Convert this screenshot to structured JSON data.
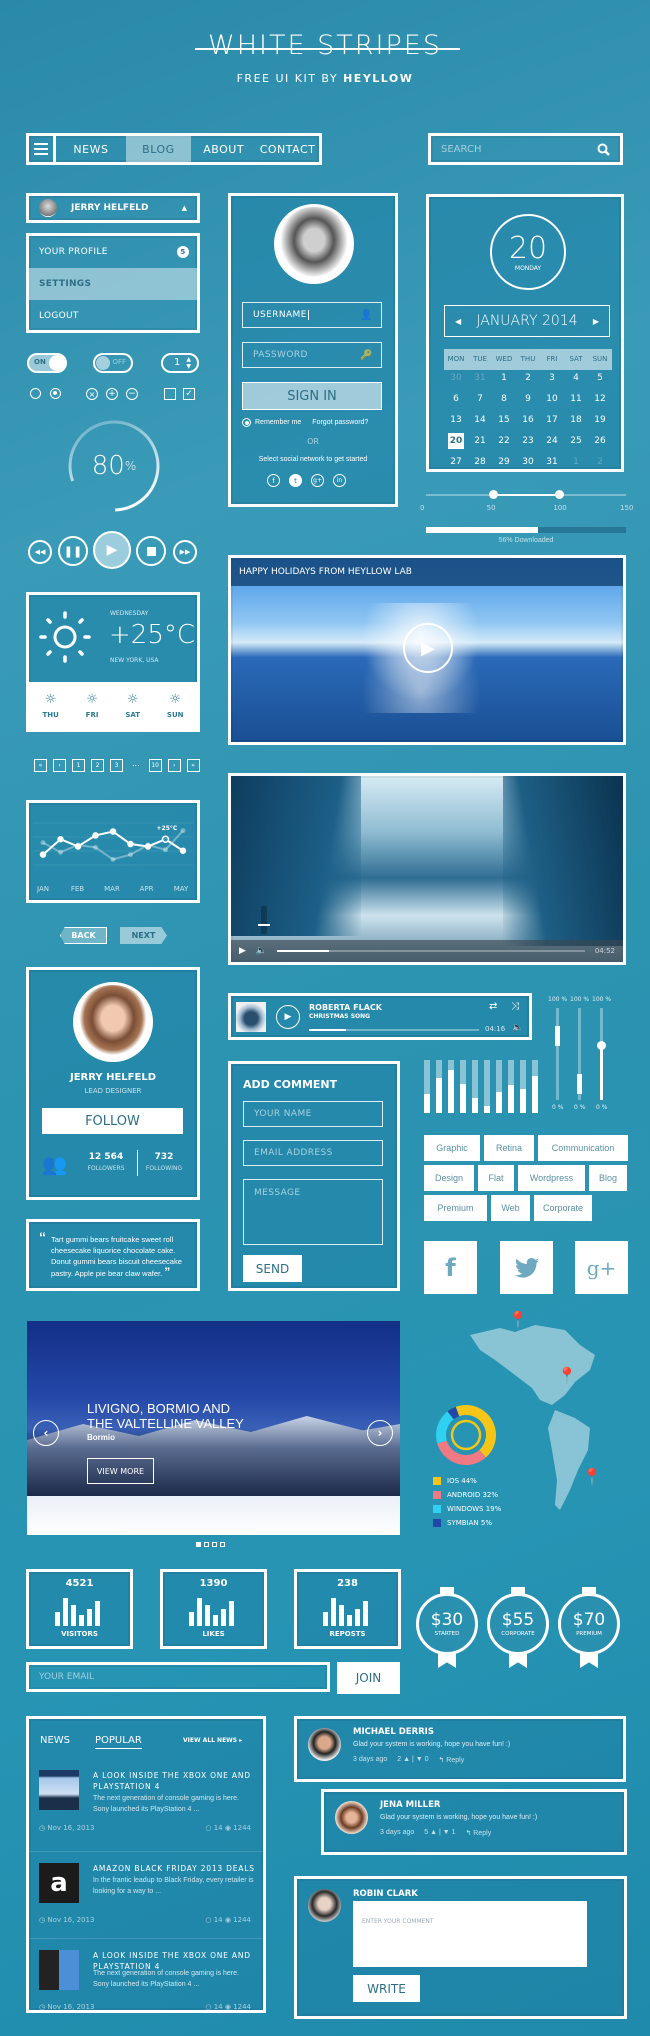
{
  "header": {
    "title": "WHITE STRIPES",
    "subtitle_prefix": "FREE UI KIT BY ",
    "subtitle_brand": "HEYLLOW"
  },
  "nav": {
    "items": [
      {
        "label": "NEWS"
      },
      {
        "label": "BLOG",
        "active": true
      },
      {
        "label": "ABOUT"
      },
      {
        "label": "CONTACT"
      }
    ],
    "search_placeholder": "SEARCH"
  },
  "user_dropdown": {
    "name": "JERRY HELFELD",
    "items": [
      {
        "label": "YOUR PROFILE",
        "badge": "5"
      },
      {
        "label": "SETTINGS",
        "active": true
      },
      {
        "label": "LOGOUT"
      }
    ]
  },
  "controls": {
    "toggle_on": "ON",
    "toggle_off": "OFF",
    "stepper_value": "1"
  },
  "progress_ring": {
    "value": 80,
    "label": "80",
    "unit": "%"
  },
  "login": {
    "username_value": "USERNAME",
    "password_placeholder": "PASSWORD",
    "sign_in": "SIGN IN",
    "remember": "Remember me",
    "forgot": "Forgot password?",
    "or": "OR",
    "social_prompt": "Select social network to get started",
    "social": [
      "f",
      "t",
      "g+",
      "in"
    ]
  },
  "calendar": {
    "day_number": "20",
    "day_name": "MONDAY",
    "month": "JANUARY 2014",
    "weekdays": [
      "MON",
      "TUE",
      "WED",
      "THU",
      "FRI",
      "SAT",
      "SUN"
    ],
    "days": [
      [
        "30",
        "31",
        "1",
        "2",
        "3",
        "4",
        "5"
      ],
      [
        "6",
        "7",
        "8",
        "9",
        "10",
        "11",
        "12"
      ],
      [
        "13",
        "14",
        "15",
        "16",
        "17",
        "18",
        "19"
      ],
      [
        "20",
        "21",
        "22",
        "23",
        "24",
        "25",
        "26"
      ],
      [
        "27",
        "28",
        "29",
        "30",
        "31",
        "1",
        "2"
      ]
    ],
    "selected": "20"
  },
  "range_slider": {
    "ticks": [
      "0",
      "50",
      "100",
      "150"
    ],
    "low": 50,
    "high": 100,
    "max": 150
  },
  "download": {
    "percent": 56,
    "label": "56% Downloaded"
  },
  "weather": {
    "day": "WEDNESDAY",
    "temp": "+25°C",
    "location": "NEW YORK, USA",
    "forecast": [
      "THU",
      "FRI",
      "SAT",
      "SUN"
    ]
  },
  "pagination": {
    "items": [
      "«",
      "‹",
      "1",
      "2",
      "3",
      "...",
      "10",
      "›",
      "»"
    ]
  },
  "line_chart": {
    "labels": [
      "JAN",
      "FEB",
      "MAR",
      "APR",
      "MAY"
    ],
    "annotation": "+25°C",
    "series_main": [
      30,
      62,
      47,
      70,
      78,
      52,
      47,
      62,
      38
    ],
    "series_faded": [
      55,
      35,
      50,
      45,
      20,
      30,
      50,
      40,
      80
    ]
  },
  "back_next": {
    "back": "BACK",
    "next": "NEXT"
  },
  "video1": {
    "title": "HAPPY HOLIDAYS FROM HEYLLOW LAB"
  },
  "video2": {
    "time": "04:52",
    "progress": 17
  },
  "profile": {
    "name": "JERRY HELFELD",
    "role": "LEAD DESIGNER",
    "follow": "FOLLOW",
    "followers": "12 564",
    "followers_label": "FOLLOWERS",
    "following": "732",
    "following_label": "FOLLOWING"
  },
  "quote": {
    "text": "Tart gummi bears fruitcake sweet roll cheesecake liquorice chocolate cake. Donut gummi bears biscuit cheesecake pastry. Apple pie bear claw wafer."
  },
  "music": {
    "artist": "ROBERTA FLACK",
    "song": "CHRISTMAS SONG",
    "time": "04:16",
    "progress": 22
  },
  "comment_form": {
    "title": "ADD COMMENT",
    "name_ph": "YOUR NAME",
    "email_ph": "EMAIL ADDRESS",
    "message_ph": "MESSAGE",
    "send": "SEND"
  },
  "equalizer": {
    "levels": [
      36,
      66,
      82,
      54,
      28,
      14,
      40,
      52,
      46,
      70
    ]
  },
  "vertical_sliders": [
    {
      "top": "100 %",
      "bottom": "0 %",
      "value": 80
    },
    {
      "top": "100 %",
      "bottom": "0 %",
      "value": 28
    },
    {
      "top": "100 %",
      "bottom": "0 %",
      "value": 60
    }
  ],
  "tags": [
    "Graphic",
    "Retina",
    "Communication",
    "Design",
    "Flat",
    "Wordpress",
    "Blog",
    "Premium",
    "Web",
    "Corporate"
  ],
  "social_buttons": [
    "f",
    "twitter",
    "g+"
  ],
  "slider": {
    "title_line1": "LIVIGNO,  BORMIO AND",
    "title_line2": "THE VALTELLINE VALLEY",
    "subtitle": "Bormio",
    "button": "VIEW MORE",
    "dots": 4,
    "active_dot": 0
  },
  "chart_data": {
    "type": "pie",
    "title": "",
    "categories": [
      "IOS",
      "ANDROID",
      "WINDOWS",
      "SYMBIAN"
    ],
    "values": [
      44,
      32,
      19,
      5
    ],
    "colors": [
      "#f5c518",
      "#f07a84",
      "#2fd0f0",
      "#2147a8"
    ],
    "legend": [
      "IOS  44%",
      "ANDROID  32%",
      "WINDOWS  19%",
      "SYMBIAN  5%"
    ]
  },
  "stats": [
    {
      "value": "4521",
      "label": "VISITORS"
    },
    {
      "value": "1390",
      "label": "LIKES"
    },
    {
      "value": "238",
      "label": "REPOSTS"
    }
  ],
  "pricing": [
    {
      "price": "$30",
      "label": "STARTED"
    },
    {
      "price": "$55",
      "label": "CORPORATE"
    },
    {
      "price": "$70",
      "label": "PREMIUM"
    }
  ],
  "newsletter": {
    "placeholder": "YOUR EMAIL",
    "button": "JOIN"
  },
  "news": {
    "tab1": "NEWS",
    "tab2": "POPULAR",
    "view_all": "VIEW ALL NEWS",
    "items": [
      {
        "title": "A LOOK INSIDE THE XBOX ONE AND PLAYSTATION 4",
        "excerpt": "The next generation of console gaming is here. Sony launched its PlayStation 4 ...",
        "date": "Nov 16, 2013",
        "comments": "14",
        "views": "1244"
      },
      {
        "title": "AMAZON BLACK FRIDAY 2013 DEALS",
        "excerpt": "In the frantic leadup to Black Friday, every retailer is looking for a way to ...",
        "date": "Nov 16, 2013",
        "comments": "14",
        "views": "1244"
      },
      {
        "title": "A LOOK INSIDE THE XBOX ONE AND PLAYSTATION 4",
        "excerpt": "The next generation of console gaming is here. Sony launched its PlayStation 4 ...",
        "date": "Nov 16, 2013",
        "comments": "14",
        "views": "1244"
      }
    ]
  },
  "comments": [
    {
      "name": "MICHAEL DERRIS",
      "text": "Glad your system is working, hope you have fun! :)",
      "time": "3 days ago",
      "up": "2",
      "down": "0",
      "reply": "Reply"
    },
    {
      "name": "JENA MILLER",
      "text": "Glad your system is working, hope you have fun! :)",
      "time": "3 days ago",
      "up": "5",
      "down": "1",
      "reply": "Reply"
    }
  ],
  "write_comment": {
    "name": "ROBIN CLARK",
    "placeholder": "ENTER YOUR COMMENT",
    "button": "WRITE"
  }
}
